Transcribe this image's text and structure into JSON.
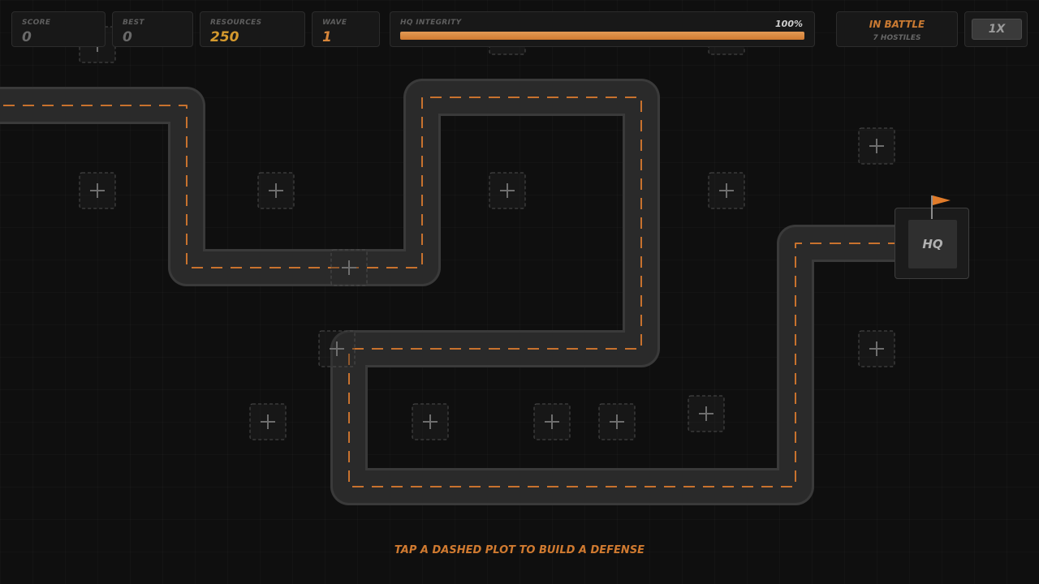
{
  "hud": {
    "score": {
      "label": "SCORE",
      "value": "0"
    },
    "best": {
      "label": "BEST",
      "value": "0"
    },
    "resources": {
      "label": "RESOURCES",
      "value": "250"
    },
    "wave": {
      "label": "WAVE",
      "value": "1"
    },
    "hq_integrity": {
      "label": "HQ INTEGRITY",
      "percent_text": "100%",
      "fraction": 1.0
    },
    "status": {
      "title": "IN BATTLE",
      "subtitle": "7 HOSTILES"
    },
    "speed": {
      "label": "1X"
    }
  },
  "hq": {
    "label": "HQ",
    "flag_color": "#e07b2a"
  },
  "hint": "TAP A DASHED PLOT TO BUILD A DEFENSE",
  "colors": {
    "road": "#2a2a2a",
    "road_edge": "#3a3a3a",
    "road_dash": "#c8722e",
    "accent": "#d07a30",
    "resources": "#d59a2e"
  },
  "build_plots": {
    "icon": "plus-icon",
    "count": 16
  }
}
